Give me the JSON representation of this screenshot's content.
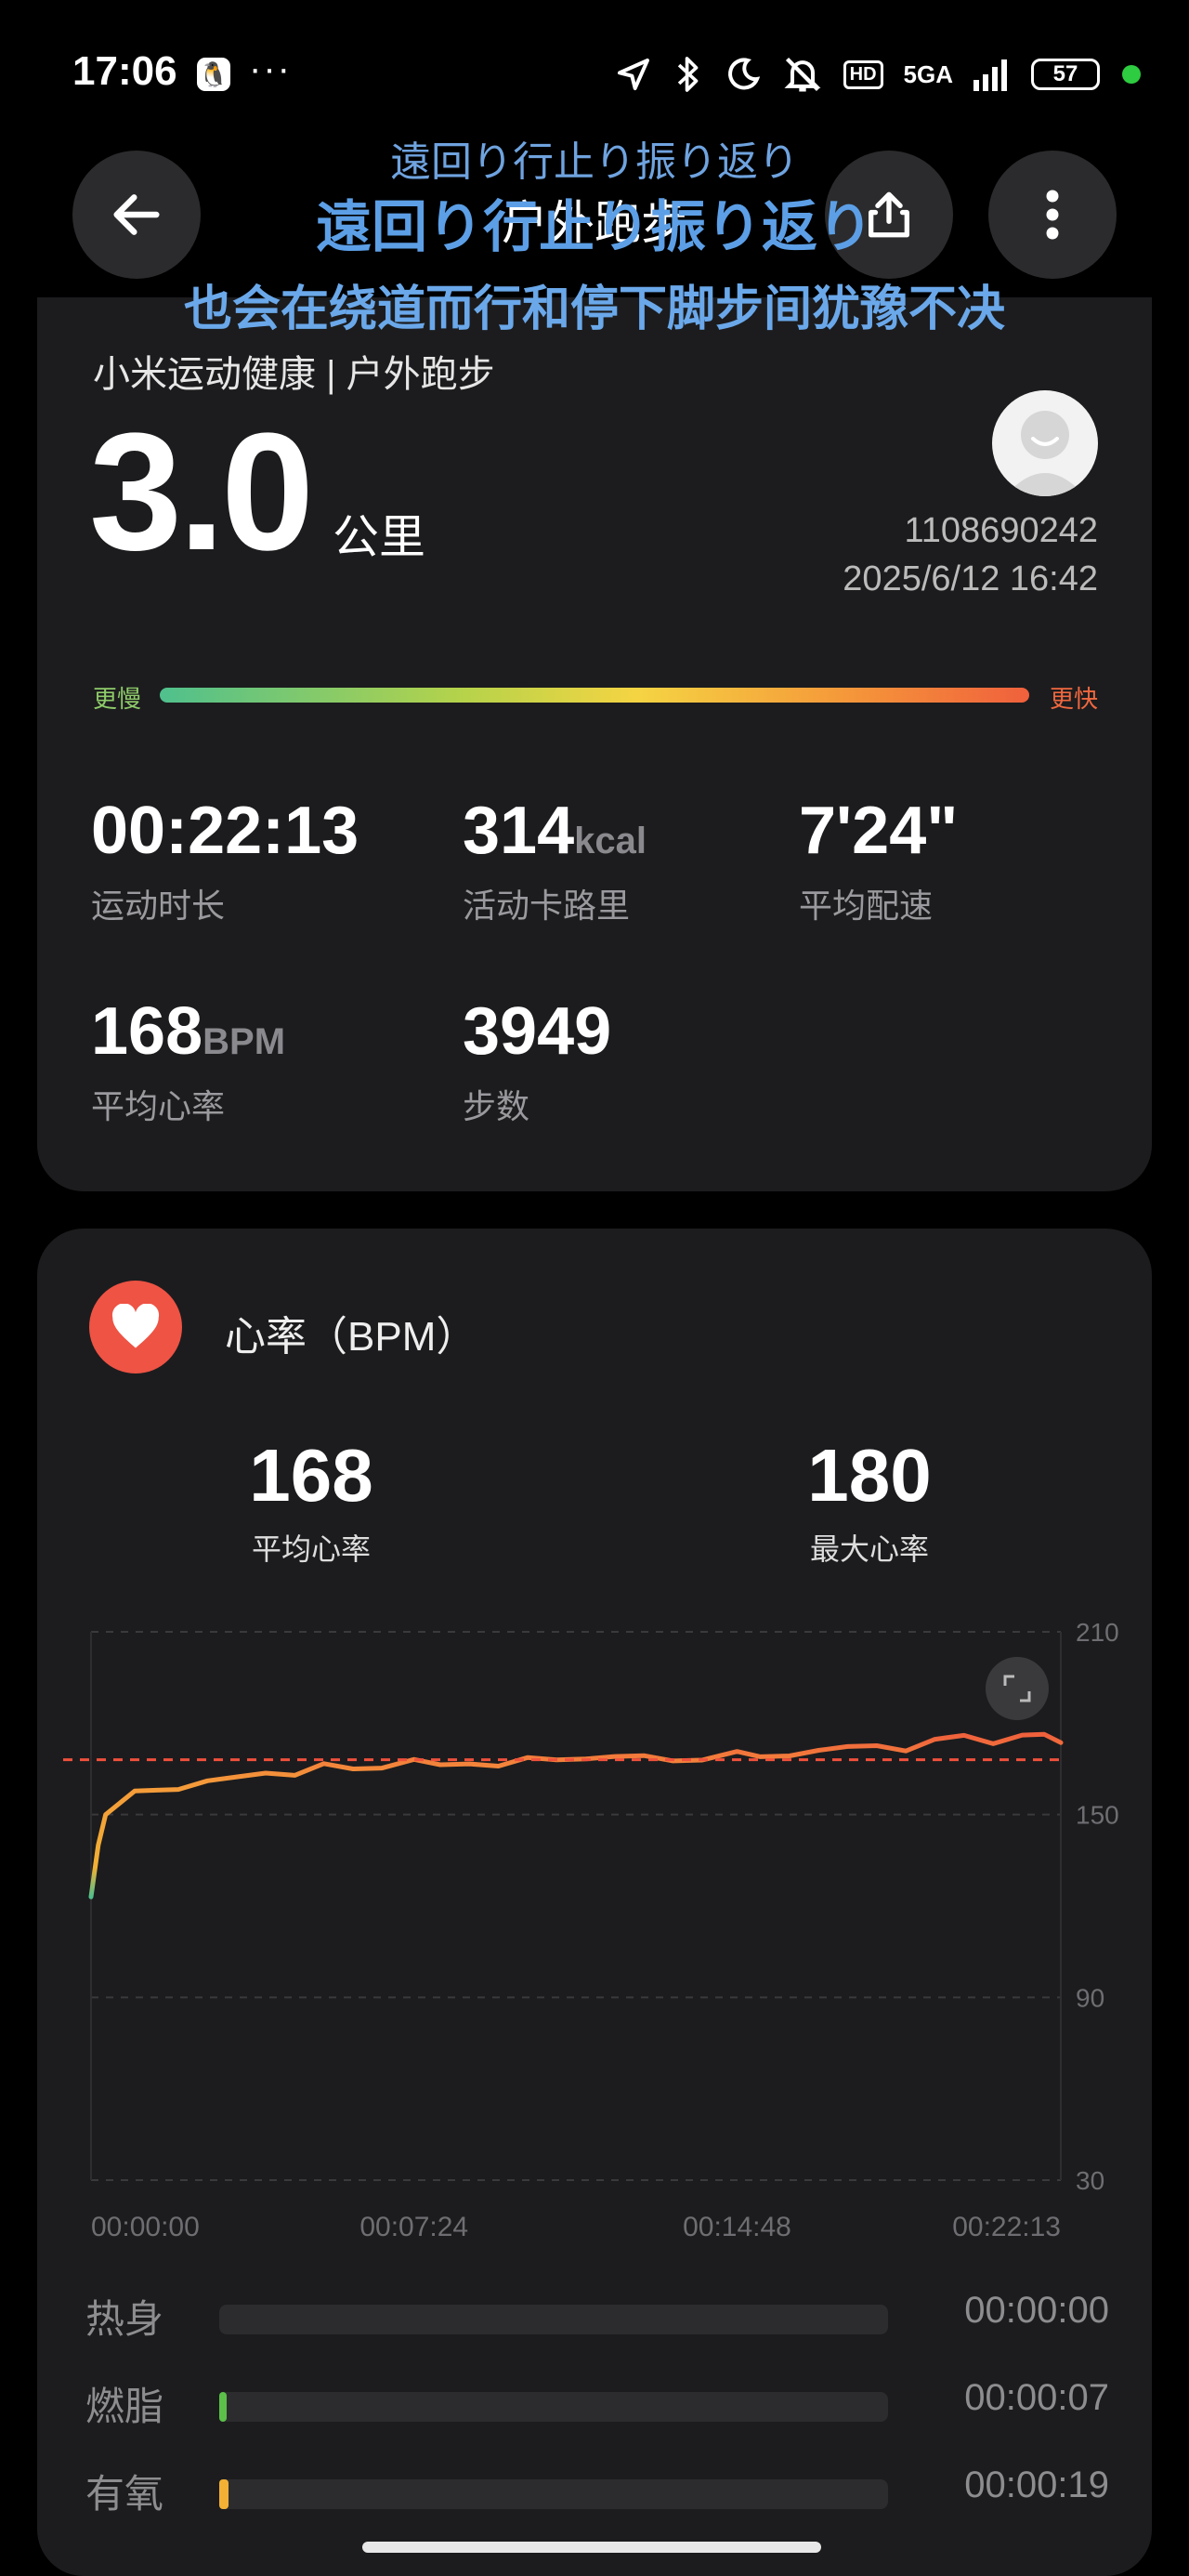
{
  "status_bar": {
    "time": "17:06",
    "more": "···",
    "hd": "HD",
    "network": "5GA",
    "battery": "57"
  },
  "header": {
    "title": "户外跑步",
    "lyric_line1": "遠回り行止り振り返り",
    "lyric_line2": "遠回り行止り振り返り",
    "lyric_line3": "也会在绕道而行和停下脚步间犹豫不决"
  },
  "summary": {
    "source": "小米运动健康 | 户外跑步",
    "distance": "3.0",
    "distance_unit": "公里",
    "user_id": "1108690242",
    "datetime": "2025/6/12 16:42",
    "pace_slow": "更慢",
    "pace_fast": "更快",
    "stats": [
      {
        "value": "00:22:13",
        "unit": "",
        "label": "运动时长"
      },
      {
        "value": "314",
        "unit": "kcal",
        "label": "活动卡路里"
      },
      {
        "value": "7'24\"",
        "unit": "",
        "label": "平均配速"
      },
      {
        "value": "168",
        "unit": "BPM",
        "label": "平均心率"
      },
      {
        "value": "3949",
        "unit": "",
        "label": "步数"
      }
    ]
  },
  "heart_rate": {
    "title": "心率（BPM）",
    "avg_value": "168",
    "avg_label": "平均心率",
    "max_value": "180",
    "max_label": "最大心率",
    "zones": [
      {
        "label": "热身",
        "time": "00:00:00",
        "color": "",
        "fraction": 0
      },
      {
        "label": "燃脂",
        "time": "00:00:07",
        "color": "#5cbf4a",
        "fraction": 0.005
      },
      {
        "label": "有氧",
        "time": "00:00:19",
        "color": "#f2b134",
        "fraction": 0.014
      }
    ]
  },
  "chart_data": {
    "type": "line",
    "title": "",
    "xlabel": "",
    "ylabel": "",
    "x_ticks": [
      "00:00:00",
      "00:07:24",
      "00:14:48",
      "00:22:13"
    ],
    "y_ticks": [
      30,
      90,
      150,
      210
    ],
    "ylim": [
      30,
      210
    ],
    "xlim_seconds": [
      0,
      1333
    ],
    "average_line": 168,
    "grid": true,
    "x": [
      0,
      10,
      20,
      35,
      60,
      90,
      120,
      160,
      200,
      240,
      280,
      320,
      360,
      400,
      444,
      480,
      520,
      560,
      600,
      640,
      680,
      720,
      760,
      800,
      840,
      888,
      920,
      960,
      1000,
      1040,
      1080,
      1120,
      1160,
      1200,
      1240,
      1280,
      1310,
      1333
    ],
    "values": [
      123,
      140,
      150,
      154,
      157,
      158,
      159,
      160,
      162,
      164,
      164,
      166,
      165,
      166,
      167,
      166,
      167,
      167,
      168,
      168,
      169,
      168,
      169,
      168,
      169,
      170,
      169,
      170,
      170,
      172,
      173,
      172,
      174,
      176,
      174,
      175,
      176,
      174
    ]
  }
}
